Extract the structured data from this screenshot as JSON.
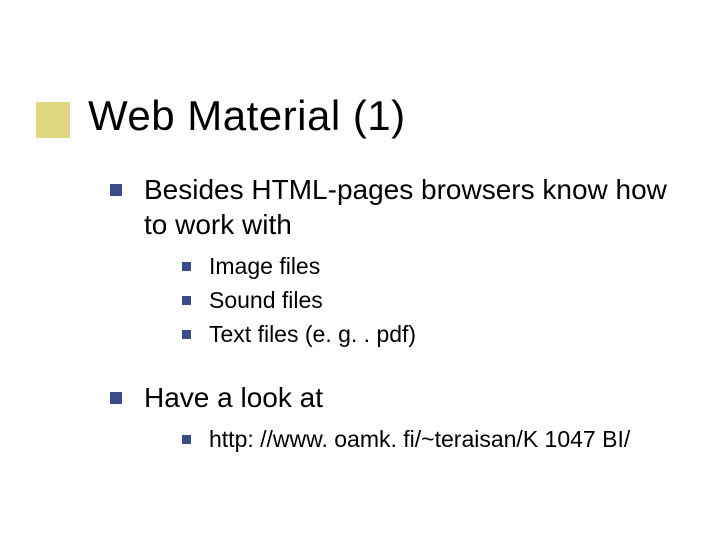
{
  "title": "Web Material (1)",
  "items": [
    {
      "text": "Besides HTML-pages browsers know how to work with",
      "sub": [
        "Image files",
        "Sound files",
        "Text files (e. g. . pdf)"
      ]
    },
    {
      "text": "Have a look at",
      "sub": [
        "http: //www. oamk. fi/~teraisan/K 1047 BI/"
      ]
    }
  ]
}
